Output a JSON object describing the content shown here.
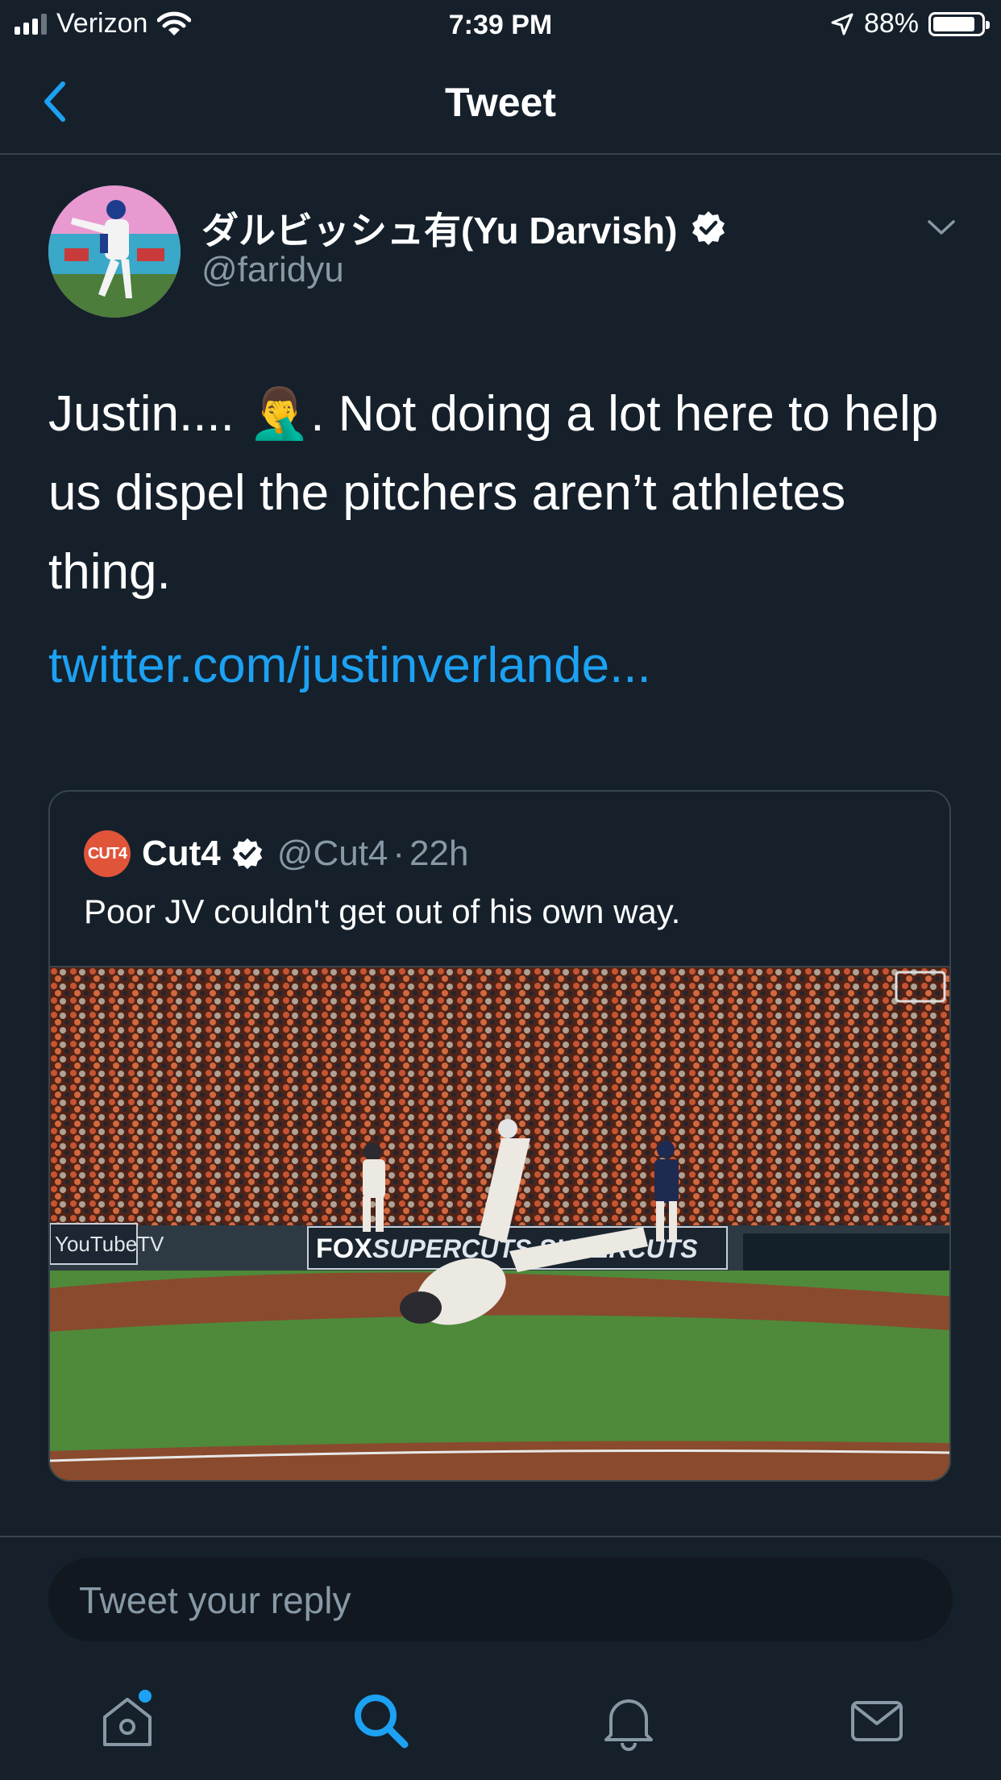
{
  "status_bar": {
    "carrier": "Verizon",
    "time": "7:39 PM",
    "battery": "88%",
    "battery_level": 0.88
  },
  "nav": {
    "title": "Tweet",
    "back_icon": "chevron-left-icon"
  },
  "tweet": {
    "author_name": "ダルビッシュ有(Yu Darvish)",
    "author_handle": "@faridyu",
    "text_part1": "Justin.... ",
    "emoji": "🤦‍♂️",
    "text_part2": ". Not doing a lot here to help us dispel the pitchers aren’t athletes thing.",
    "link": "twitter.com/justinverlande..."
  },
  "quote": {
    "avatar_text": "CUT4",
    "name": "Cut4",
    "handle": "@Cut4",
    "separator": "·",
    "time": "22h",
    "text": "Poor JV couldn't get out of his own way.",
    "media_labels": {
      "left_sign": "YouTubeTV",
      "fox": "FOX",
      "banner": "SUPERCUTS SUPERCUTS"
    }
  },
  "reply": {
    "placeholder": "Tweet your reply"
  },
  "tabs": [
    {
      "name": "home",
      "active": false,
      "badge": true
    },
    {
      "name": "search",
      "active": true
    },
    {
      "name": "notifications",
      "active": false
    },
    {
      "name": "messages",
      "active": false
    }
  ],
  "colors": {
    "background": "#15202b",
    "accent": "#1da1f2",
    "muted": "#8899a6",
    "border": "#38444d"
  }
}
